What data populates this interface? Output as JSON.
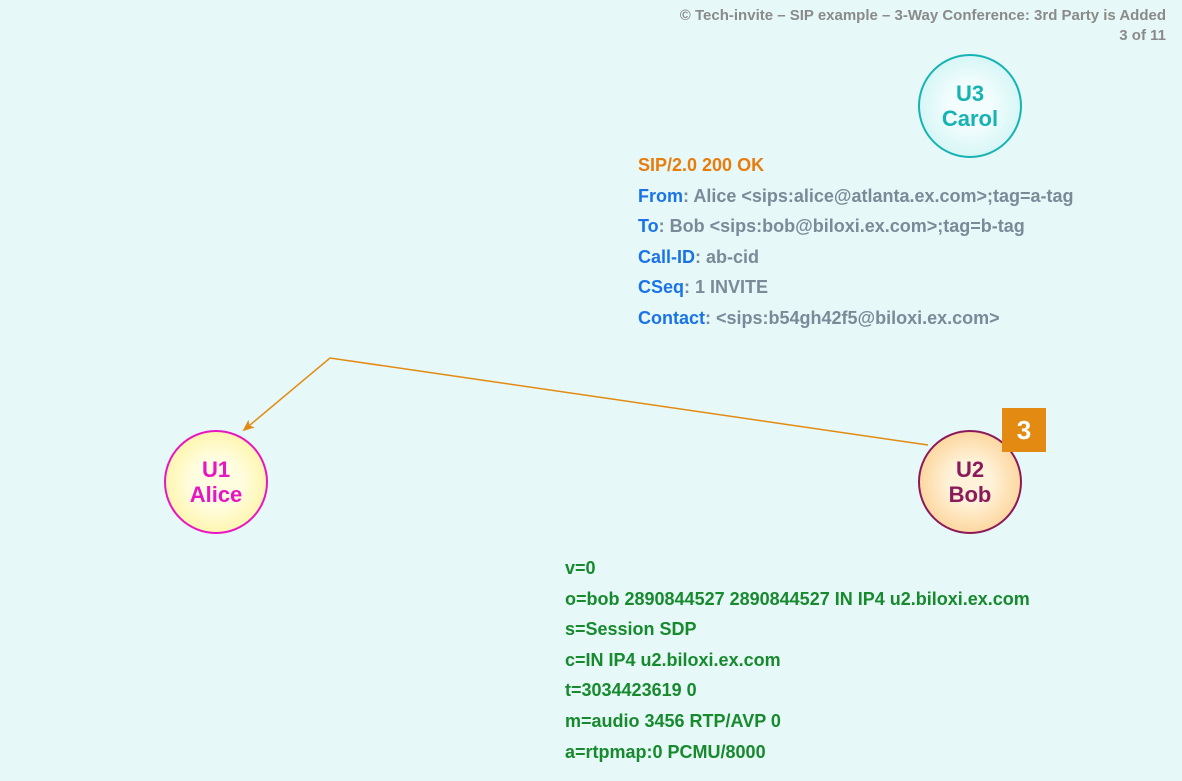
{
  "header": {
    "copyright": "© Tech-invite – SIP example – 3-Way Conference: 3rd Party is Added",
    "pager": "3 of 11"
  },
  "step": "3",
  "nodes": {
    "alice": {
      "id": "U1",
      "name": "Alice"
    },
    "bob": {
      "id": "U2",
      "name": "Bob"
    },
    "carol": {
      "id": "U3",
      "name": "Carol"
    }
  },
  "sip": {
    "status": "SIP/2.0 200 OK",
    "from_label": "From",
    "from_value": ": Alice <sips:alice@atlanta.ex.com>;tag=a-tag",
    "to_label": "To",
    "to_value": ": Bob <sips:bob@biloxi.ex.com>;tag=b-tag",
    "callid_label": "Call-ID",
    "callid_value": ": ab-cid",
    "cseq_label": "CSeq",
    "cseq_value": ": 1 INVITE",
    "contact_label": "Contact",
    "contact_value": ": <sips:b54gh42f5@biloxi.ex.com>"
  },
  "sdp": {
    "l1": "v=0",
    "l2": "o=bob  2890844527  2890844527  IN  IP4  u2.biloxi.ex.com",
    "l3": "s=Session SDP",
    "l4": "c=IN  IP4  u2.biloxi.ex.com",
    "l5": "t=3034423619  0",
    "l6": "m=audio  3456  RTP/AVP  0",
    "l7": "a=rtpmap:0  PCMU/8000"
  }
}
